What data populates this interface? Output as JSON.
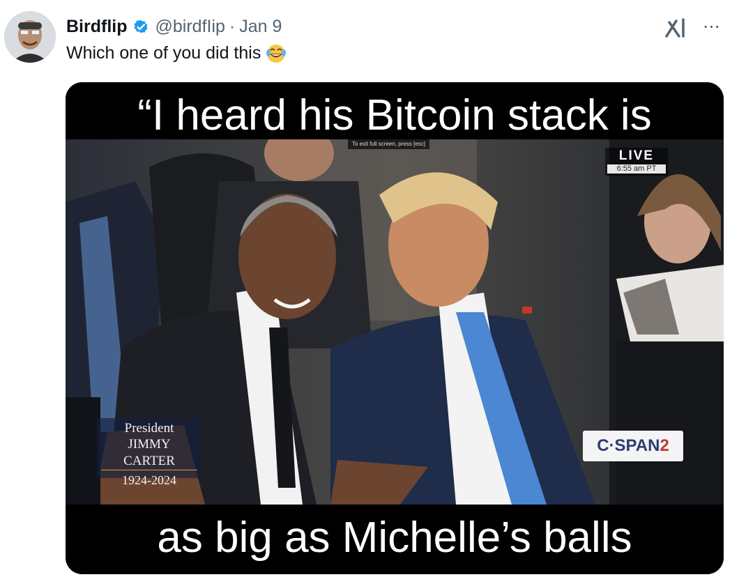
{
  "tweet": {
    "display_name": "Birdflip",
    "handle": "@birdfIip",
    "separator": "·",
    "date": "Jan 9",
    "text": "Which one of you did this",
    "emoji": "face-with-tears-of-joy",
    "verified": true,
    "more_label": "···"
  },
  "media": {
    "caption_top": "“I heard his Bitcoin stack is",
    "caption_bottom": "as big as Michelle’s balls",
    "esc_hint": "To exit full screen, press [esc]",
    "live": {
      "label": "LIVE",
      "time": "6:55 am PT"
    },
    "chyron": {
      "title": "President",
      "name": "JIMMY CARTER",
      "years": "1924-2024"
    },
    "network_logo": {
      "main": "C·SPAN",
      "number": "2"
    }
  },
  "colors": {
    "verified_badge": "#1d9bf0",
    "secondary_text": "#536471",
    "primary_text": "#0f1419",
    "cspan_blue": "#2a3d6e",
    "cspan_red": "#c0392b"
  },
  "icons": {
    "verified": "verified-badge-icon",
    "grok": "grok-icon",
    "more": "more-icon"
  }
}
